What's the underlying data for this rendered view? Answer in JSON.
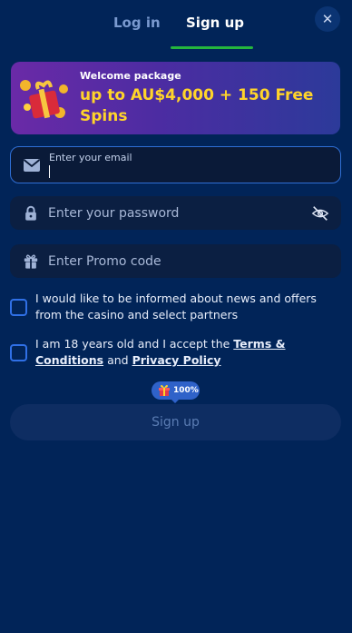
{
  "tabs": {
    "login": "Log in",
    "signup": "Sign up"
  },
  "promo": {
    "small": "Welcome package",
    "big": "up to AU$4,000 + 150 Free Spins"
  },
  "email": {
    "label": "Enter your email",
    "value": ""
  },
  "password": {
    "placeholder": "Enter your password"
  },
  "promo_code": {
    "placeholder": "Enter Promo code"
  },
  "consent": {
    "news": "I would like to be informed about news and offers from the casino and select partners",
    "age_prefix": "I am 18 years old and I accept the ",
    "terms_link": "Terms & Conditions",
    "and": " and ",
    "privacy_link": "Privacy Policy"
  },
  "bonus_badge": "100%",
  "signup_button": "Sign up",
  "colors": {
    "accent": "#25b63d",
    "brand_bg": "#012458",
    "promo_text": "#ffd42a"
  }
}
